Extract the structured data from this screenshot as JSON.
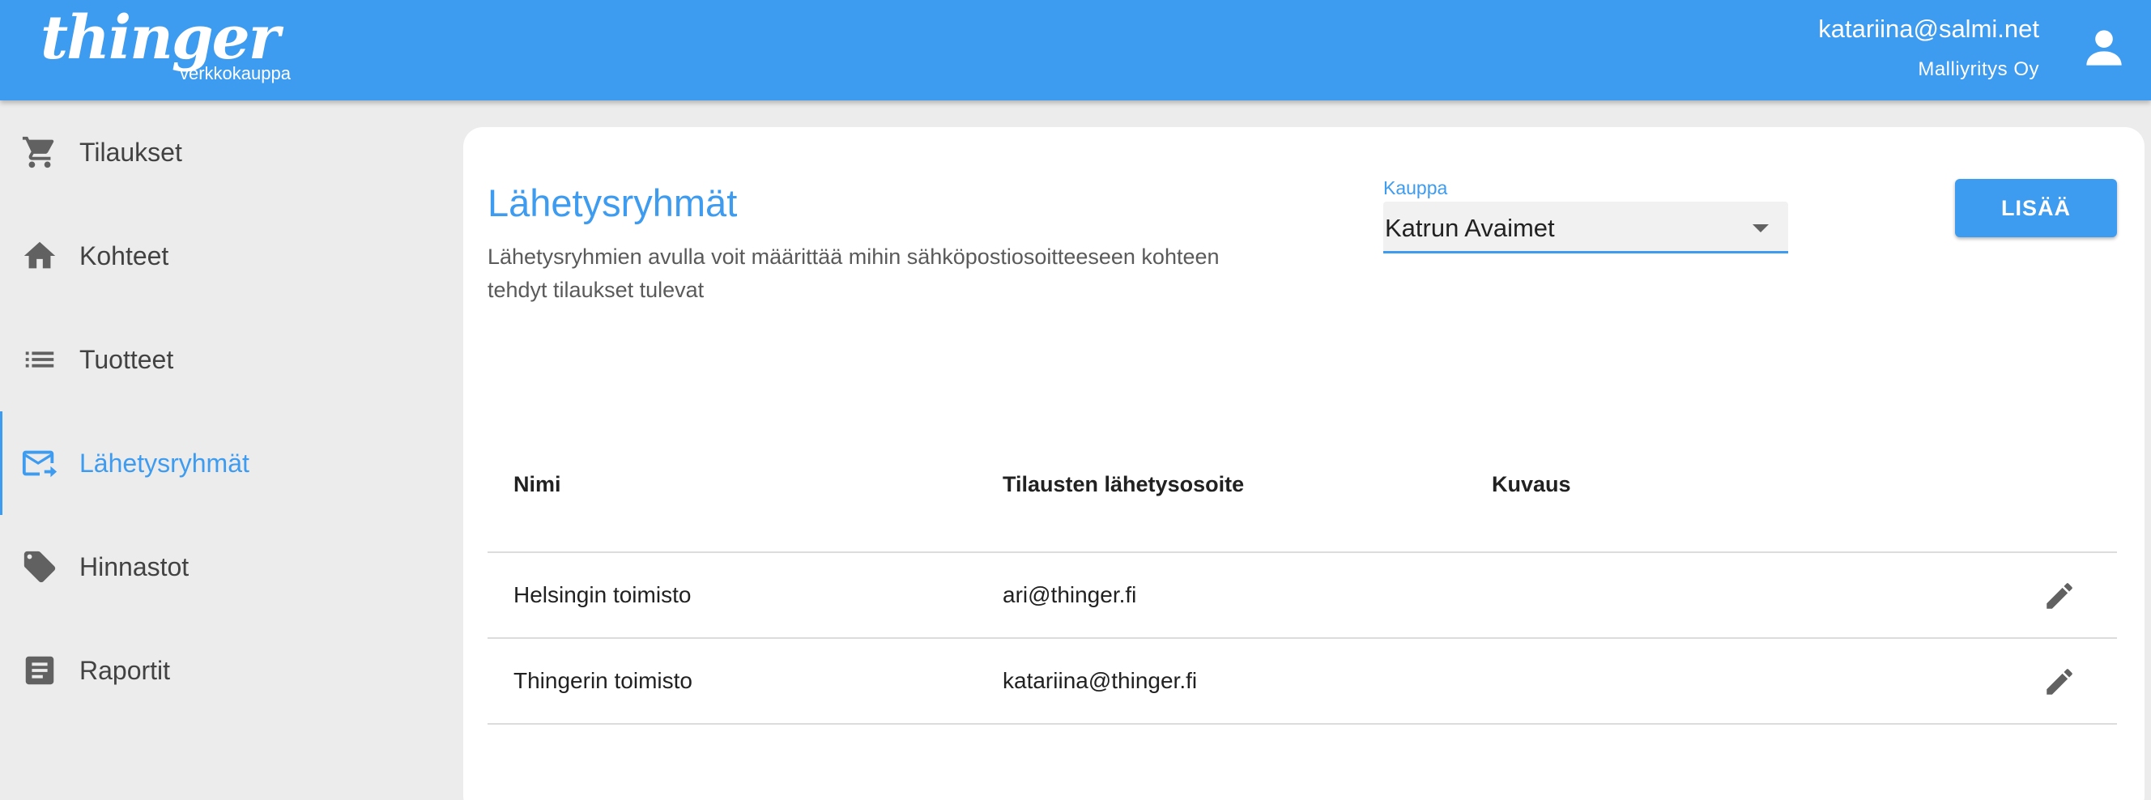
{
  "header": {
    "logo_text": "thinger",
    "logo_subtitle": "verkkokauppa",
    "user_email": "katariina@salmi.net",
    "user_company": "Malliyritys Oy",
    "avatar_icon": "account-icon",
    "brand_color": "#3d9bf0"
  },
  "sidebar": {
    "items": [
      {
        "label": "Tilaukset",
        "icon": "cart-icon",
        "active": false
      },
      {
        "label": "Kohteet",
        "icon": "home-icon",
        "active": false
      },
      {
        "label": "Tuotteet",
        "icon": "list-icon",
        "active": false
      },
      {
        "label": "Lähetysryhmät",
        "icon": "email-send-icon",
        "active": true
      },
      {
        "label": "Hinnastot",
        "icon": "tag-icon",
        "active": false
      },
      {
        "label": "Raportit",
        "icon": "report-icon",
        "active": false
      }
    ]
  },
  "main": {
    "title": "Lähetysryhmät",
    "description": "Lähetysryhmien avulla voit määrittää mihin sähköpostiosoitteeseen kohteen tehdyt tilaukset tulevat",
    "store_select": {
      "label": "Kauppa",
      "value": "Katrun Avaimet"
    },
    "add_button_label": "LISÄÄ",
    "table": {
      "columns": [
        "Nimi",
        "Tilausten lähetysosoite",
        "Kuvaus"
      ],
      "rows": [
        {
          "name": "Helsingin toimisto",
          "email": "ari@thinger.fi",
          "description": ""
        },
        {
          "name": "Thingerin toimisto",
          "email": "katariina@thinger.fi",
          "description": ""
        }
      ]
    }
  }
}
